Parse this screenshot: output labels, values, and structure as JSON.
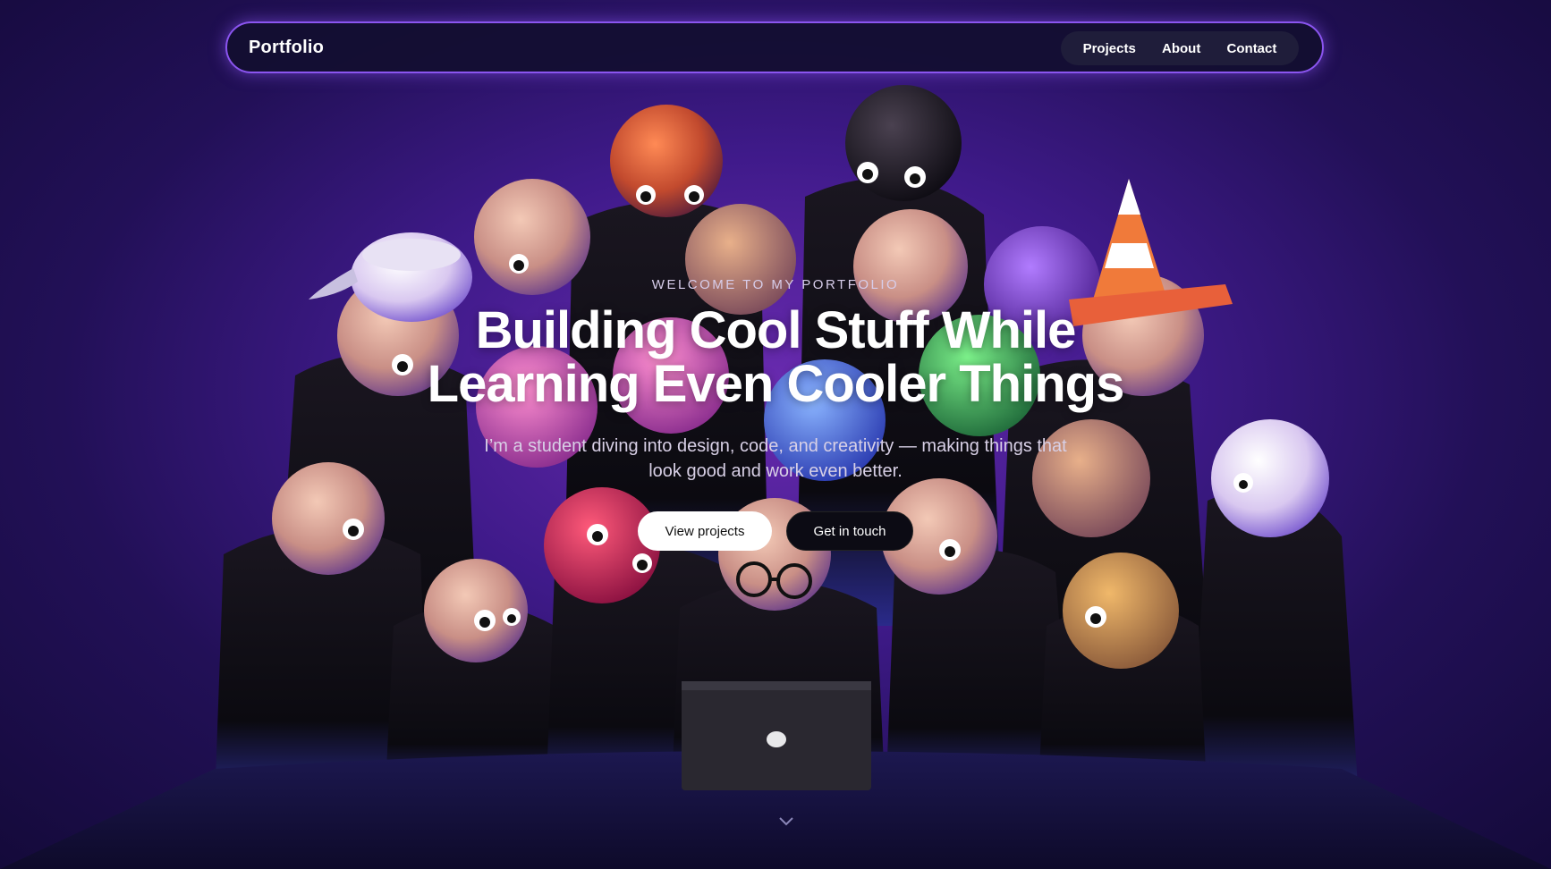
{
  "nav": {
    "brand": "Portfolio",
    "links": [
      "Projects",
      "About",
      "Contact"
    ]
  },
  "hero": {
    "eyebrow": "WELCOME TO MY PORTFOLIO",
    "headline_line1": "Building Cool Stuff While",
    "headline_line2": "Learning Even Cooler Things",
    "subtitle": "I’m a student diving into design, code, and creativity — making things that look good and work even better.",
    "primary_button": "View projects",
    "secondary_button": "Get in touch"
  },
  "icons": {
    "scroll_down": "chevron-down-icon"
  },
  "colors": {
    "accent_border": "#8b55f0",
    "background_top": "#6a2bb0",
    "background_bottom": "#140a3a"
  }
}
